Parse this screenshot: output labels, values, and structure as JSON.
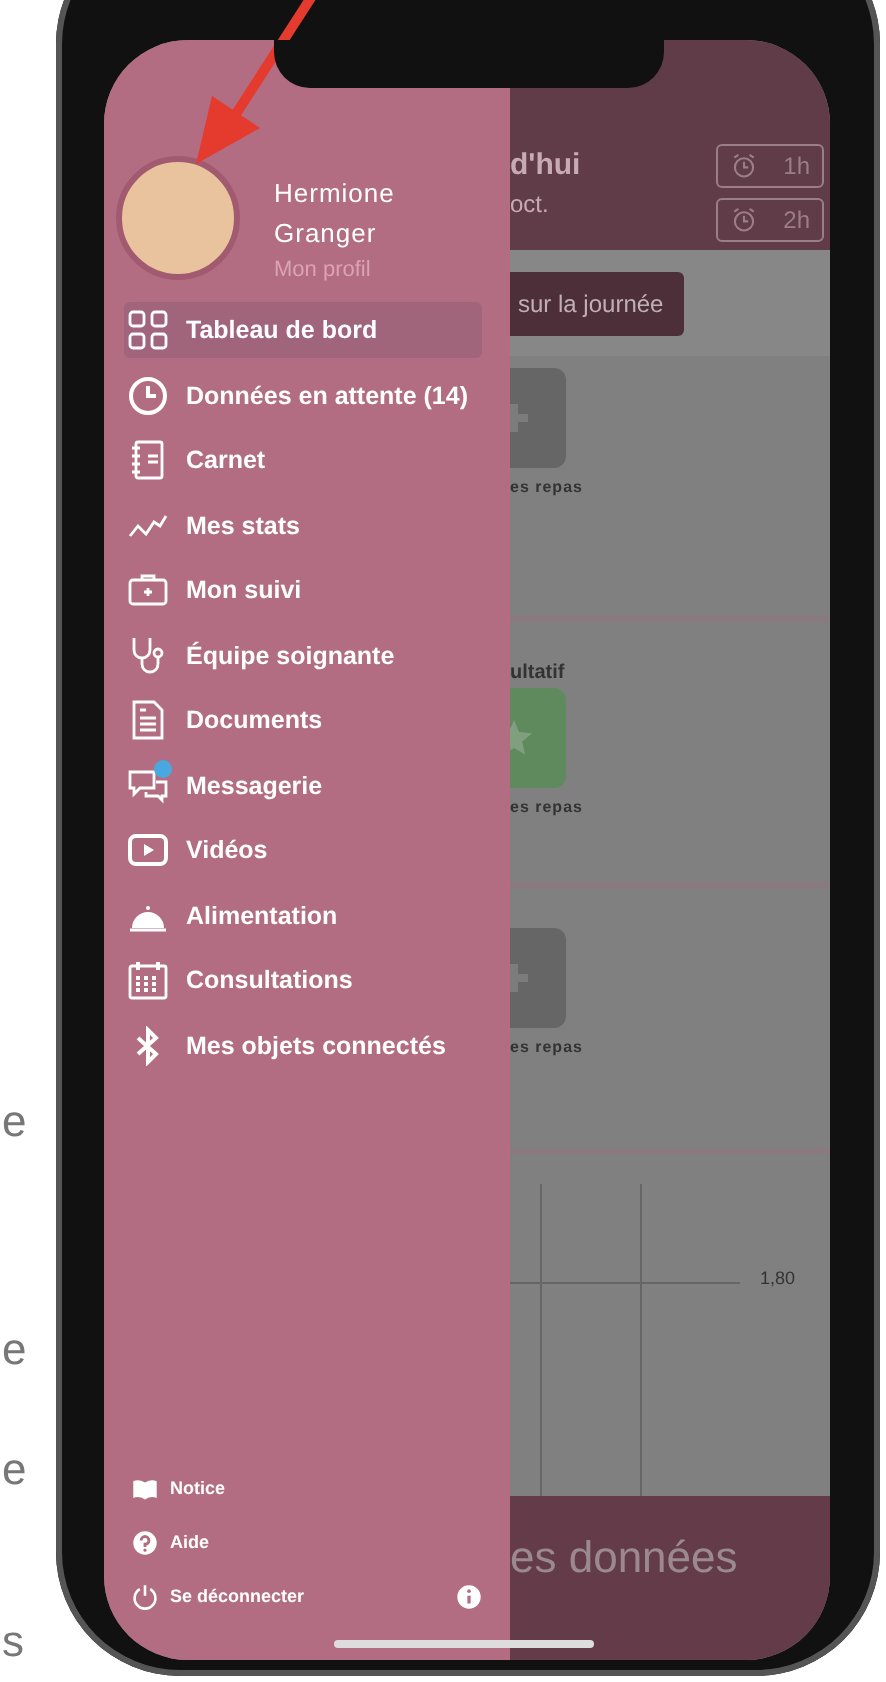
{
  "page_fragments": [
    "e",
    "e",
    "e",
    "s"
  ],
  "profile": {
    "first_name": "Hermione",
    "last_name": "Granger",
    "link": "Mon profil"
  },
  "menu": [
    {
      "label": "Tableau de bord",
      "kind": "grid",
      "selected": true,
      "unread": false
    },
    {
      "label": "Données en attente (14)",
      "kind": "clock",
      "selected": false,
      "unread": false
    },
    {
      "label": "Carnet",
      "kind": "notebook",
      "selected": false,
      "unread": false
    },
    {
      "label": "Mes stats",
      "kind": "stats",
      "selected": false,
      "unread": false
    },
    {
      "label": "Mon suivi",
      "kind": "kit",
      "selected": false,
      "unread": false
    },
    {
      "label": "Équipe soignante",
      "kind": "stethoscope",
      "selected": false,
      "unread": false
    },
    {
      "label": "Documents",
      "kind": "document",
      "selected": false,
      "unread": false
    },
    {
      "label": "Messagerie",
      "kind": "chat",
      "selected": false,
      "unread": true
    },
    {
      "label": "Vidéos",
      "kind": "video",
      "selected": false,
      "unread": false
    },
    {
      "label": "Alimentation",
      "kind": "cloche",
      "selected": false,
      "unread": false
    },
    {
      "label": "Consultations",
      "kind": "calendar",
      "selected": false,
      "unread": false
    },
    {
      "label": "Mes objets connectés",
      "kind": "bluetooth",
      "selected": false,
      "unread": false
    }
  ],
  "footer": [
    {
      "label": "Notice",
      "kind": "book"
    },
    {
      "label": "Aide",
      "kind": "help"
    },
    {
      "label": "Se déconnecter",
      "kind": "power"
    }
  ],
  "background": {
    "header": {
      "line_1": "d'hui",
      "line_2": "oct.",
      "alarms": [
        "1h",
        "2h"
      ]
    },
    "day_button": "sur la journée",
    "sections": [
      {
        "kind": "plus",
        "caption": "es repas"
      },
      {
        "title": "ultatif",
        "kind": "star",
        "caption": "es repas"
      },
      {
        "kind": "plus",
        "caption": "es repas"
      }
    ],
    "chart_label": "1,80",
    "bottom_button": "es données"
  }
}
